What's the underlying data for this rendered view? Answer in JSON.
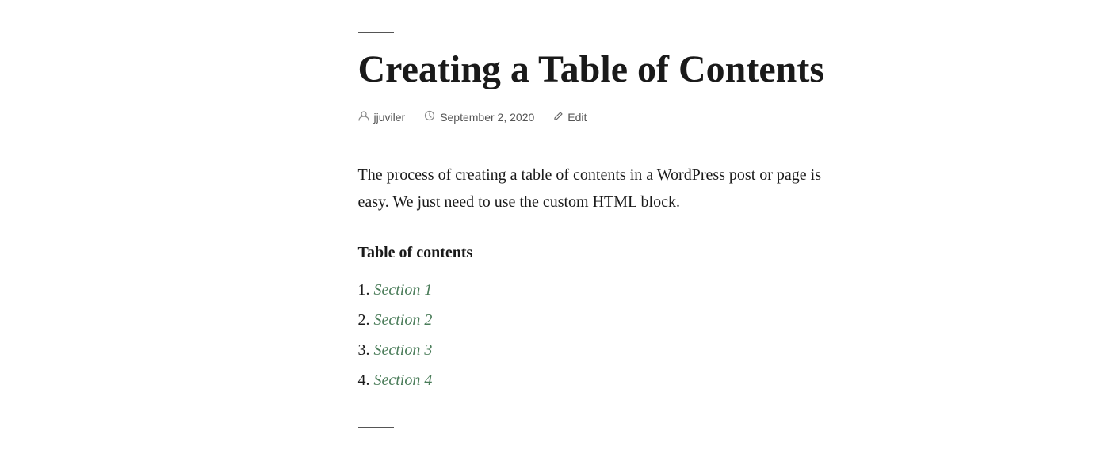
{
  "page": {
    "top_rule": true,
    "title": "Creating a Table of Contents",
    "meta": {
      "author": {
        "icon": "👤",
        "name": "jjuviler"
      },
      "date": {
        "icon": "🕐",
        "value": "September 2, 2020"
      },
      "edit": {
        "icon": "✏",
        "label": "Edit"
      }
    },
    "body": "The process of creating a table of contents in a WordPress post or page is easy. We just need to use the custom HTML block.",
    "toc": {
      "heading": "Table of contents",
      "items": [
        {
          "number": "1.",
          "label": "Section 1",
          "href": "#section-1"
        },
        {
          "number": "2.",
          "label": "Section 2",
          "href": "#section-2"
        },
        {
          "number": "3.",
          "label": "Section 3",
          "href": "#section-3"
        },
        {
          "number": "4.",
          "label": "Section 4",
          "href": "#section-4"
        }
      ]
    }
  }
}
